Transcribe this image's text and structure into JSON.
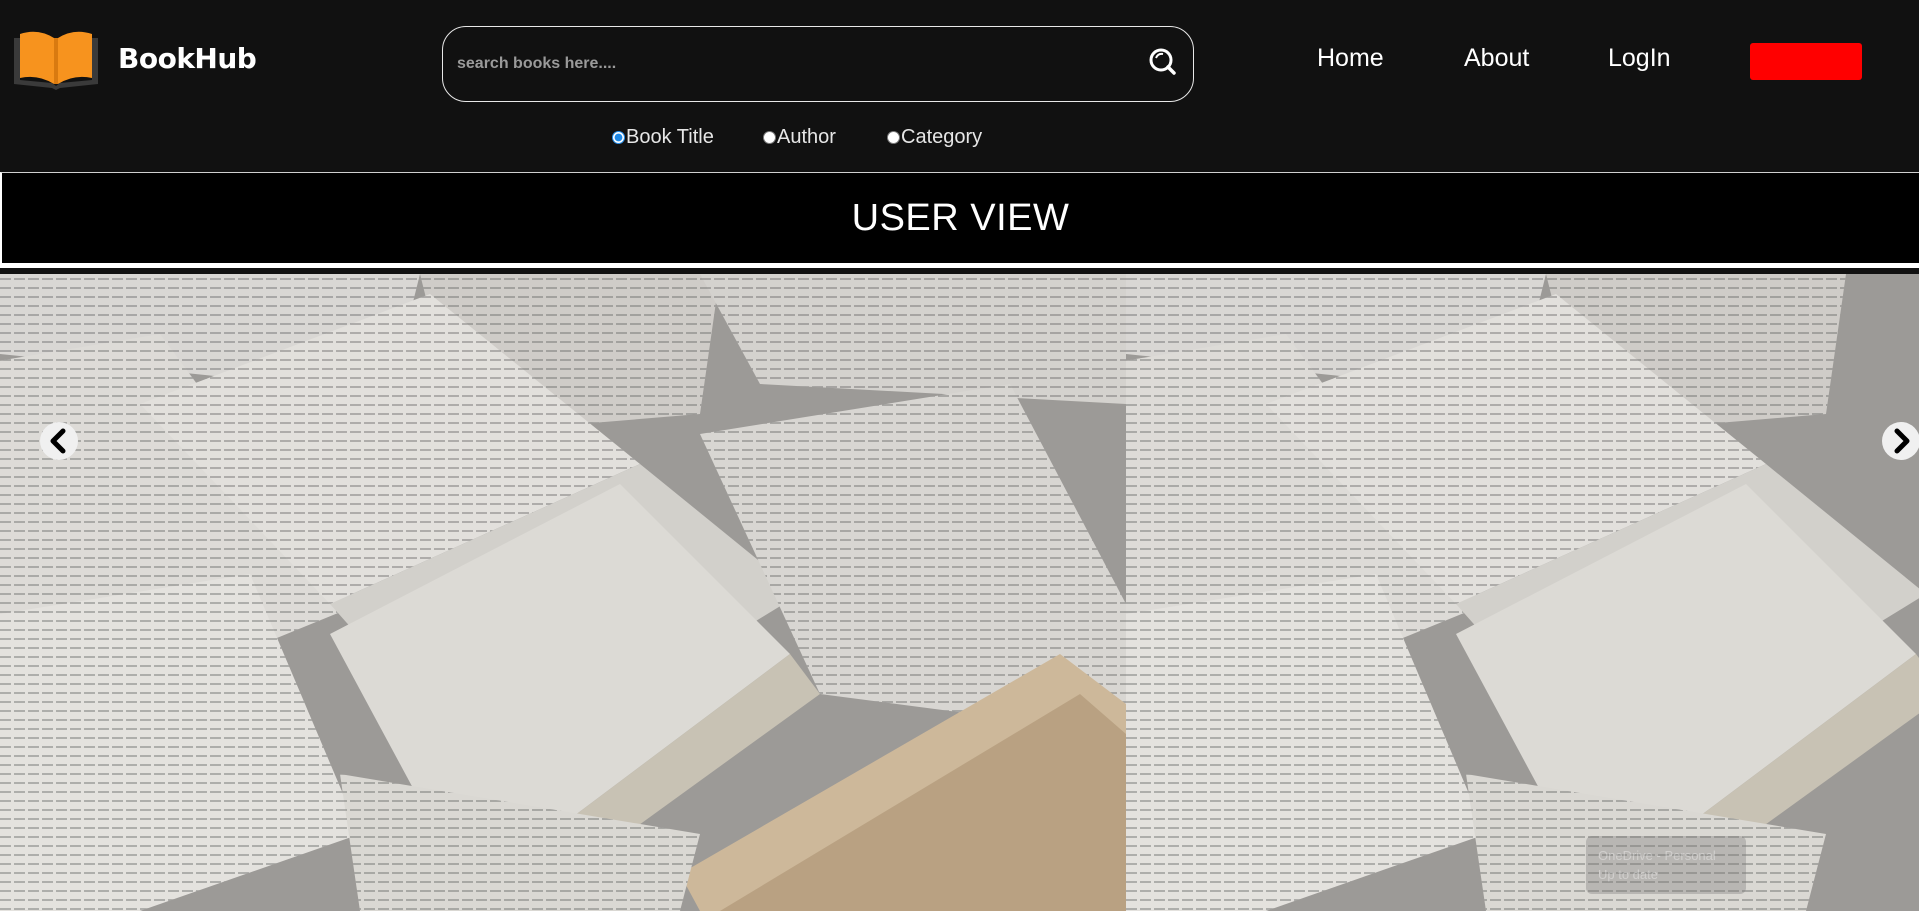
{
  "header": {
    "brand": "BookHub",
    "search": {
      "placeholder": "search books here....",
      "value": ""
    },
    "filters": [
      {
        "label": "Book Title",
        "checked": true
      },
      {
        "label": "Author",
        "checked": false
      },
      {
        "label": "Category",
        "checked": false
      }
    ],
    "nav": {
      "home": "Home",
      "about": "About",
      "login": "LogIn"
    },
    "accent_button_color": "#ff0000"
  },
  "banner": {
    "title": "USER VIEW"
  },
  "carousel": {
    "prev_icon": "chevron-left-icon",
    "next_icon": "chevron-right-icon",
    "slide_image": "open-books-photo"
  },
  "toast": {
    "line1": "OneDrive - Personal",
    "line2": "Up to date"
  },
  "colors": {
    "header_bg": "#111111",
    "logo_orange": "#f7931e",
    "banner_bg": "#000000"
  }
}
